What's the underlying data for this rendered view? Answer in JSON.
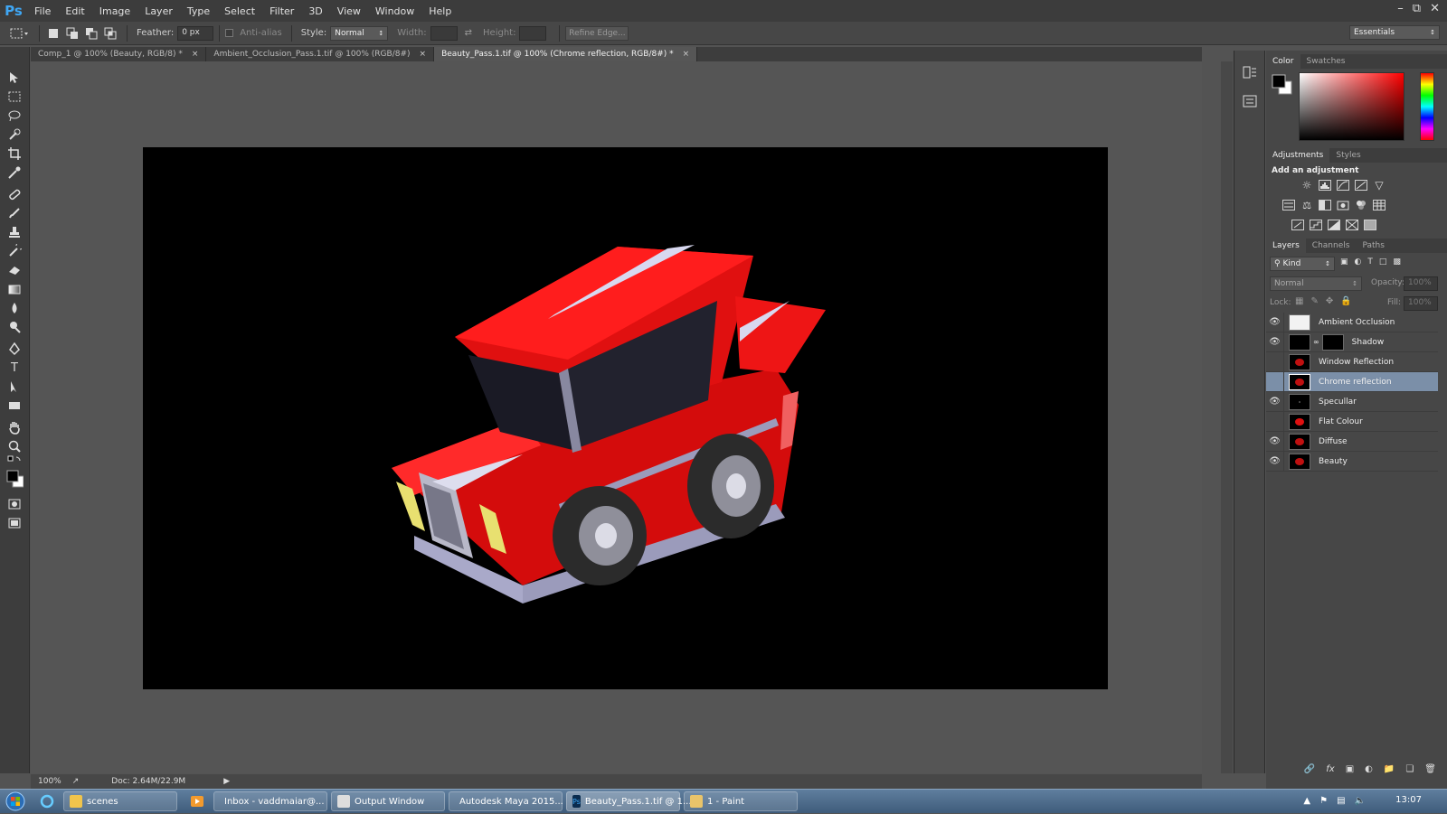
{
  "app": {
    "logo": "Ps",
    "menu": [
      "File",
      "Edit",
      "Image",
      "Layer",
      "Type",
      "Select",
      "Filter",
      "3D",
      "View",
      "Window",
      "Help"
    ]
  },
  "options": {
    "feather_label": "Feather:",
    "feather_value": "0 px",
    "anti_alias_label": "Anti-alias",
    "style_label": "Style:",
    "style_value": "Normal",
    "width_label": "Width:",
    "height_label": "Height:",
    "refine_edge_label": "Refine Edge...",
    "workspace_value": "Essentials"
  },
  "tabs": [
    {
      "label": "Comp_1 @ 100% (Beauty, RGB/8) *",
      "active": false
    },
    {
      "label": "Ambient_Occlusion_Pass.1.tif @ 100% (RGB/8#)",
      "active": false
    },
    {
      "label": "Beauty_Pass.1.tif @ 100% (Chrome reflection, RGB/8#) *",
      "active": true
    }
  ],
  "status": {
    "zoom": "100%",
    "doc_size": "Doc: 2.64M/22.9M"
  },
  "color_panel": {
    "tabs": [
      "Color",
      "Swatches"
    ]
  },
  "adjustments_panel": {
    "tabs": [
      "Adjustments",
      "Styles"
    ],
    "heading": "Add an adjustment"
  },
  "layers_panel": {
    "tabs": [
      "Layers",
      "Channels",
      "Paths"
    ],
    "filter_value": "Kind",
    "blend_mode": "Normal",
    "opacity_label": "Opacity:",
    "opacity_value": "100%",
    "lock_label": "Lock:",
    "fill_label": "Fill:",
    "fill_value": "100%",
    "layers": [
      {
        "name": "Ambient Occlusion",
        "visible": true,
        "selected": false
      },
      {
        "name": "Shadow",
        "visible": true,
        "selected": false
      },
      {
        "name": "Window Reflection",
        "visible": false,
        "selected": false
      },
      {
        "name": "Chrome reflection",
        "visible": false,
        "selected": true
      },
      {
        "name": "Specullar",
        "visible": true,
        "selected": false
      },
      {
        "name": "Flat Colour",
        "visible": false,
        "selected": false
      },
      {
        "name": "Diffuse",
        "visible": true,
        "selected": false
      },
      {
        "name": "Beauty",
        "visible": true,
        "selected": false
      }
    ]
  },
  "taskbar": {
    "items": [
      "scenes",
      "Inbox - vaddmaiar@...",
      "Output Window",
      "Autodesk Maya 2015...",
      "Beauty_Pass.1.tif @ 1...",
      "1 - Paint"
    ],
    "clock": "13:07"
  },
  "colors": {
    "accent_selected": "#7b8fa8",
    "car_red": "#e81010",
    "ps_blue": "#3fa7f5"
  }
}
